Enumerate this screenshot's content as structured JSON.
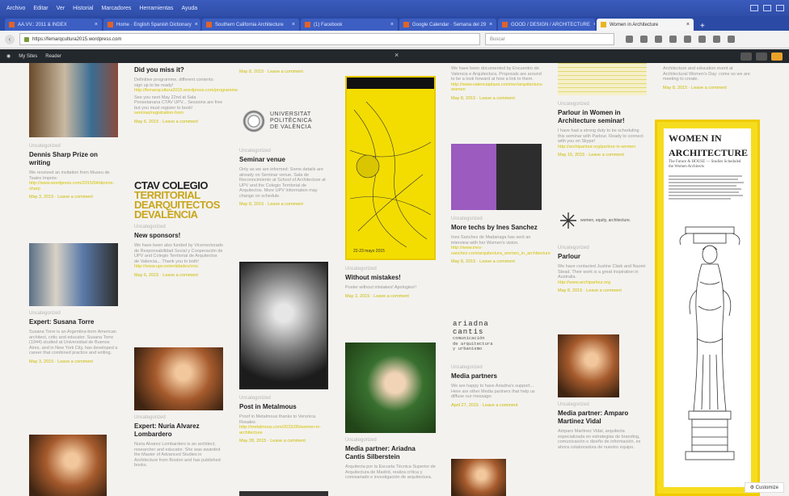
{
  "browser": {
    "menu": [
      "Archivo",
      "Editar",
      "Ver",
      "Historial",
      "Marcadores",
      "Herramientas",
      "Ayuda"
    ],
    "tabs": [
      {
        "label": "AA.VV.: 2011 & INDEX"
      },
      {
        "label": "Home · English Spanish Dictionary"
      },
      {
        "label": "Southern California Architecture"
      },
      {
        "label": "(1) Facebook"
      },
      {
        "label": "Google Calendar · Semana del 29"
      },
      {
        "label": "GOOD / DESIGN / ARCHITECTURE"
      },
      {
        "label": "Women in Architecture",
        "active": true
      }
    ],
    "url": "https://femarqcultura2015.wordpress.com",
    "search_placeholder": "Buscar"
  },
  "admin_bar": {
    "my_sites": "My Sites",
    "reader": "Reader"
  },
  "posts": {
    "dennis": {
      "category": "Uncategorized",
      "title": "Dennis Sharp Prize on writing",
      "excerpt": "We received an invitation from Museu de Teatro Imprès:",
      "link": "http://www.wordpress.com/2015/04/dennis-sharp",
      "meta": "May 3, 2015 · Leave a comment"
    },
    "missed": {
      "title": "Did you miss it?",
      "excerpt": "Definitive programme, different contents: sign up to be ready!",
      "link": "http://femarqcultura2015.wordpress.com/programme",
      "excerpt2": "See you next May 22nd at Sala Ponsetanana CTAV UPV... Sessions are free but you must register to book!",
      "link2": "seminar/registration-form",
      "meta": "May 6, 2015 · Leave a comment"
    },
    "upv_logo": {
      "line1": "UNIVERSITAT",
      "line2": "POLITÈCNICA",
      "line3": "DE VALÈNCIA"
    },
    "seminar": {
      "category": "Uncategorized",
      "title": "Seminar venue",
      "excerpt": "Only as we are informed: Some details are already on Seminar venue. Sala de Reconocimiento at School of Architecture at UPV and the Colegio Territorial de Arquitectos. More UPV information may change on schedule.",
      "meta": "May 8, 2015 · Leave a comment"
    },
    "ctav_logo": {
      "line1": "CTAV COLEGIO",
      "line2": "TERRITORIAL",
      "line3": "DEARQUITECTOS",
      "line4": "DEVALÈNCIA"
    },
    "sponsors": {
      "category": "Uncategorized",
      "title": "New sponsors!",
      "excerpt": "We have been also funded by Vicerrectorado de Responsabilidad Social y Cooperación de UPV and Colegio Territorial de Arquitectos de Valencia... Thank you to both!",
      "link": "http://www.upv.es/entidades/vrsc",
      "meta": "May 6, 2015 · Leave a comment"
    },
    "susana": {
      "category": "Uncategorized",
      "title": "Expert: Susana Torre",
      "excerpt": "Susana Torre is an Argentina-born American architect, critic and educator. Susana Torre (1944) studied at Universidad de Buenos Aires, and in New York City, has developed a career that combined practice and writing.",
      "meta": "May 3, 2015 · Leave a comment"
    },
    "nuria": {
      "category": "Uncategorized",
      "title": "Expert: Nuria Alvarez Lombardero",
      "excerpt": "Nuria Alvarez Lombardero is an architect, researcher and educator. She was awarded the Master of Advanced Studies in Architecture from Boston and has published books."
    },
    "poster_dates": {
      "dates": "22-23 mayo 2015"
    },
    "without": {
      "category": "Uncategorized",
      "title": "Without mistakes!",
      "excerpt": "Poster without mistakes! Apologies!!",
      "meta": "May 3, 2015 · Leave a comment"
    },
    "metalmous": {
      "category": "Uncategorized",
      "title": "Post in Metalmous",
      "excerpt": "Proof in Metalmous thanks to Veronica Rosales",
      "link": "http://metalmous.com/2015/05/women-in-architecture",
      "meta": "May 28, 2015 · Leave a comment"
    },
    "arianna_post": {
      "category": "Uncategorized",
      "title": "Media partner: Ariadna Cantis Silberstein",
      "excerpt": "Arquitecta por la Escuela Técnica Superior de Arquitectura de Madrid, realiza crítica y comisariado e investigación de arquitectura."
    },
    "top_col4": {
      "excerpt": "We have been documented by Encuentro de Valencia e Arquitectura. Proposals are around to be a look forward at how a link to them.",
      "link": "http://www.valenciaplaza.com/ver/arquitectura-women",
      "meta": "May 8, 2015 · Leave a comment"
    },
    "more_tech": {
      "category": "Uncategorized",
      "title": "More techs by Ines Sanchez",
      "excerpt": "Ines Sanchez de Madariaga has sent an interview with her Women's vision.",
      "link": "http://www.ines-sanchez.com/arquitectura_women_in_architecture",
      "meta": "May 8, 2015 · Leave a comment"
    },
    "ariadna_logo": {
      "line1": "ariadna",
      "line2": "cantis",
      "sub1": "comunicación",
      "sub2": "de arquitectura",
      "sub3": "y urbanismo"
    },
    "media_partners": {
      "category": "Uncategorized",
      "title": "Media partners",
      "excerpt": "We are happy to have Ariadna's support... Here are other Media partners that help us diffuse our message:",
      "meta": "April 27, 2015 · Leave a comment"
    },
    "parlour_women": {
      "category": "Uncategorized",
      "title": "Parlour in Women in Architecture seminar!",
      "excerpt": "I have had a strong duty to be scheduling this seminar with Parlour. Ready to connect with you on Skype!",
      "link": "http://archiparlour.org/parlour-in-women",
      "meta": "May 15, 2015 · Leave a comment"
    },
    "parlour_logo": {
      "text": "women, equity, architecture."
    },
    "parlour": {
      "category": "Uncategorized",
      "title": "Parlour",
      "excerpt": "We have contacted Justine Clark and Naomi Stead. Their work is a great inspiration in Australia.",
      "link": "http://www.archiparlour.org",
      "meta": "May 8, 2015 · Leave a comment"
    },
    "amparo": {
      "category": "Uncategorized",
      "title": "Media partner: Amparo Martinez Vidal",
      "excerpt": "Amparo Martinez Vidal, arquitecta especializada en estrategias de branding, comunicación e diseño de información, es ahora colaboradora de nuestro equipo."
    },
    "top_col5_meta": {
      "meta": "May 8, 2015 · Leave a comment",
      "top_excerpt": "Architecture and education event at Architectural Women's Day: come so we are meeting to create."
    }
  },
  "sidebar": {
    "title_line1": "WOMEN IN",
    "title_line2": "ARCHITECTURE",
    "subtitle": "The Future & HOUSE — Studies Scheduled the Women Architects",
    "customize": "Customize"
  },
  "colors": {
    "accent_yellow": "#f3dd00",
    "link_yellow": "#d2c200",
    "admin_bg": "#23282d"
  }
}
